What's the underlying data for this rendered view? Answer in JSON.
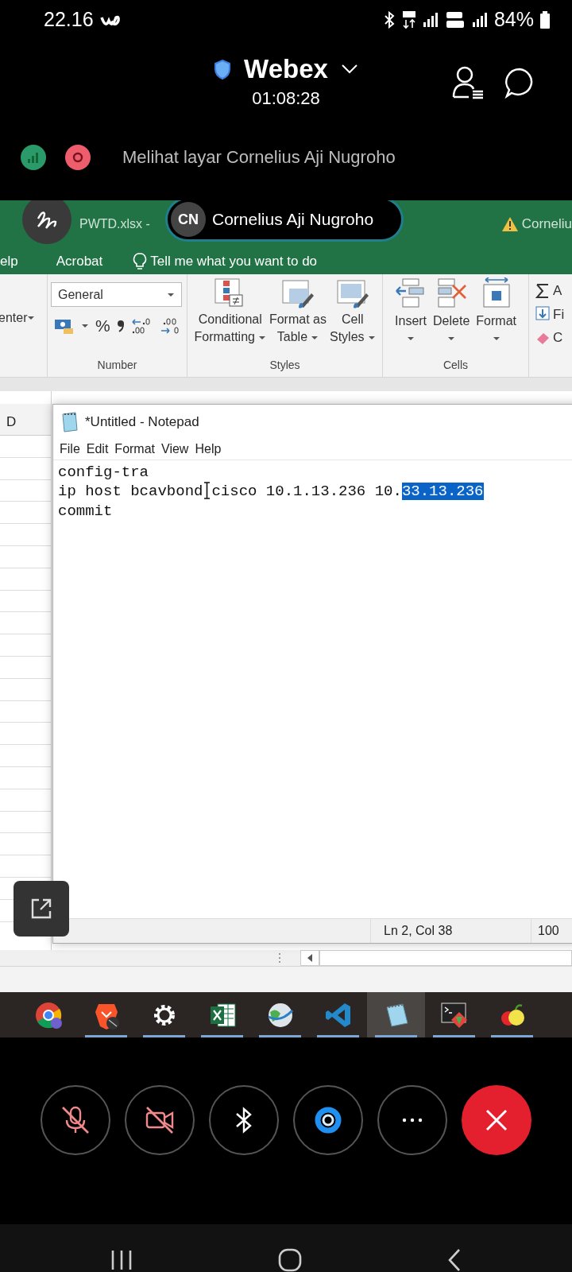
{
  "phone_status": {
    "time": "22.16",
    "battery": "84%"
  },
  "meeting": {
    "title": "Webex",
    "timer": "01:08:28"
  },
  "banner": {
    "text": "Melihat layar Cornelius Aji Nugroho"
  },
  "presenter": {
    "initials": "CN",
    "name": "Cornelius Aji Nugroho"
  },
  "excel": {
    "file_name": "PWTD.xlsx  -",
    "account": "Corneliu",
    "menu": [
      "elp",
      "Acrobat"
    ],
    "tell_me": "Tell me what you want to do",
    "alignment_cut": "enter",
    "number_format": "General",
    "percent": "%",
    "groups": [
      "Number",
      "Styles",
      "Cells"
    ],
    "styles_buttons": [
      {
        "kind": "conditional",
        "lines": [
          "Conditional",
          "Formatting"
        ]
      },
      {
        "kind": "table",
        "lines": [
          "Format as",
          "Table"
        ]
      },
      {
        "kind": "cellstyles",
        "lines": [
          "Cell",
          "Styles"
        ]
      }
    ],
    "cells_buttons": [
      {
        "kind": "insert",
        "label": "Insert"
      },
      {
        "kind": "delete",
        "label": "Delete"
      },
      {
        "kind": "format",
        "label": "Format"
      }
    ],
    "editing_cut": [
      {
        "kind": "sum",
        "label": "A"
      },
      {
        "kind": "fill",
        "label": "Fi"
      },
      {
        "kind": "clear",
        "label": "C"
      }
    ],
    "column_header": "D"
  },
  "notepad": {
    "title": "*Untitled - Notepad",
    "menu": [
      "File",
      "Edit",
      "Format",
      "View",
      "Help"
    ],
    "lines": [
      {
        "segments": [
          {
            "kind": "text",
            "text": "config-tra",
            "selected": false
          }
        ]
      },
      {
        "segments": [
          {
            "kind": "text",
            "text": "ip host bcavbond",
            "selected": false
          },
          {
            "kind": "cursor"
          },
          {
            "kind": "text",
            "text": "cisco 10.1.13.236 10.",
            "selected": false
          },
          {
            "kind": "text",
            "text": "33.13.236",
            "selected": true
          }
        ]
      },
      {
        "segments": [
          {
            "kind": "text",
            "text": "commit",
            "selected": false
          }
        ]
      }
    ],
    "position": "Ln 2, Col 38",
    "zoom": "100"
  },
  "taskbar": [
    {
      "kind": "chrome",
      "running": false,
      "selected": false
    },
    {
      "kind": "brave",
      "running": true,
      "selected": false
    },
    {
      "kind": "settings",
      "running": true,
      "selected": false
    },
    {
      "kind": "excel",
      "running": true,
      "selected": false
    },
    {
      "kind": "globe",
      "running": true,
      "selected": false
    },
    {
      "kind": "vscode",
      "running": true,
      "selected": false
    },
    {
      "kind": "notepad",
      "running": true,
      "selected": true
    },
    {
      "kind": "terminal",
      "running": true,
      "selected": false
    },
    {
      "kind": "fruit",
      "running": true,
      "selected": false
    }
  ],
  "call_controls": [
    {
      "kind": "mic",
      "off": true
    },
    {
      "kind": "camera",
      "off": true
    },
    {
      "kind": "bluetooth"
    },
    {
      "kind": "ring"
    },
    {
      "kind": "more"
    },
    {
      "kind": "leave"
    }
  ]
}
